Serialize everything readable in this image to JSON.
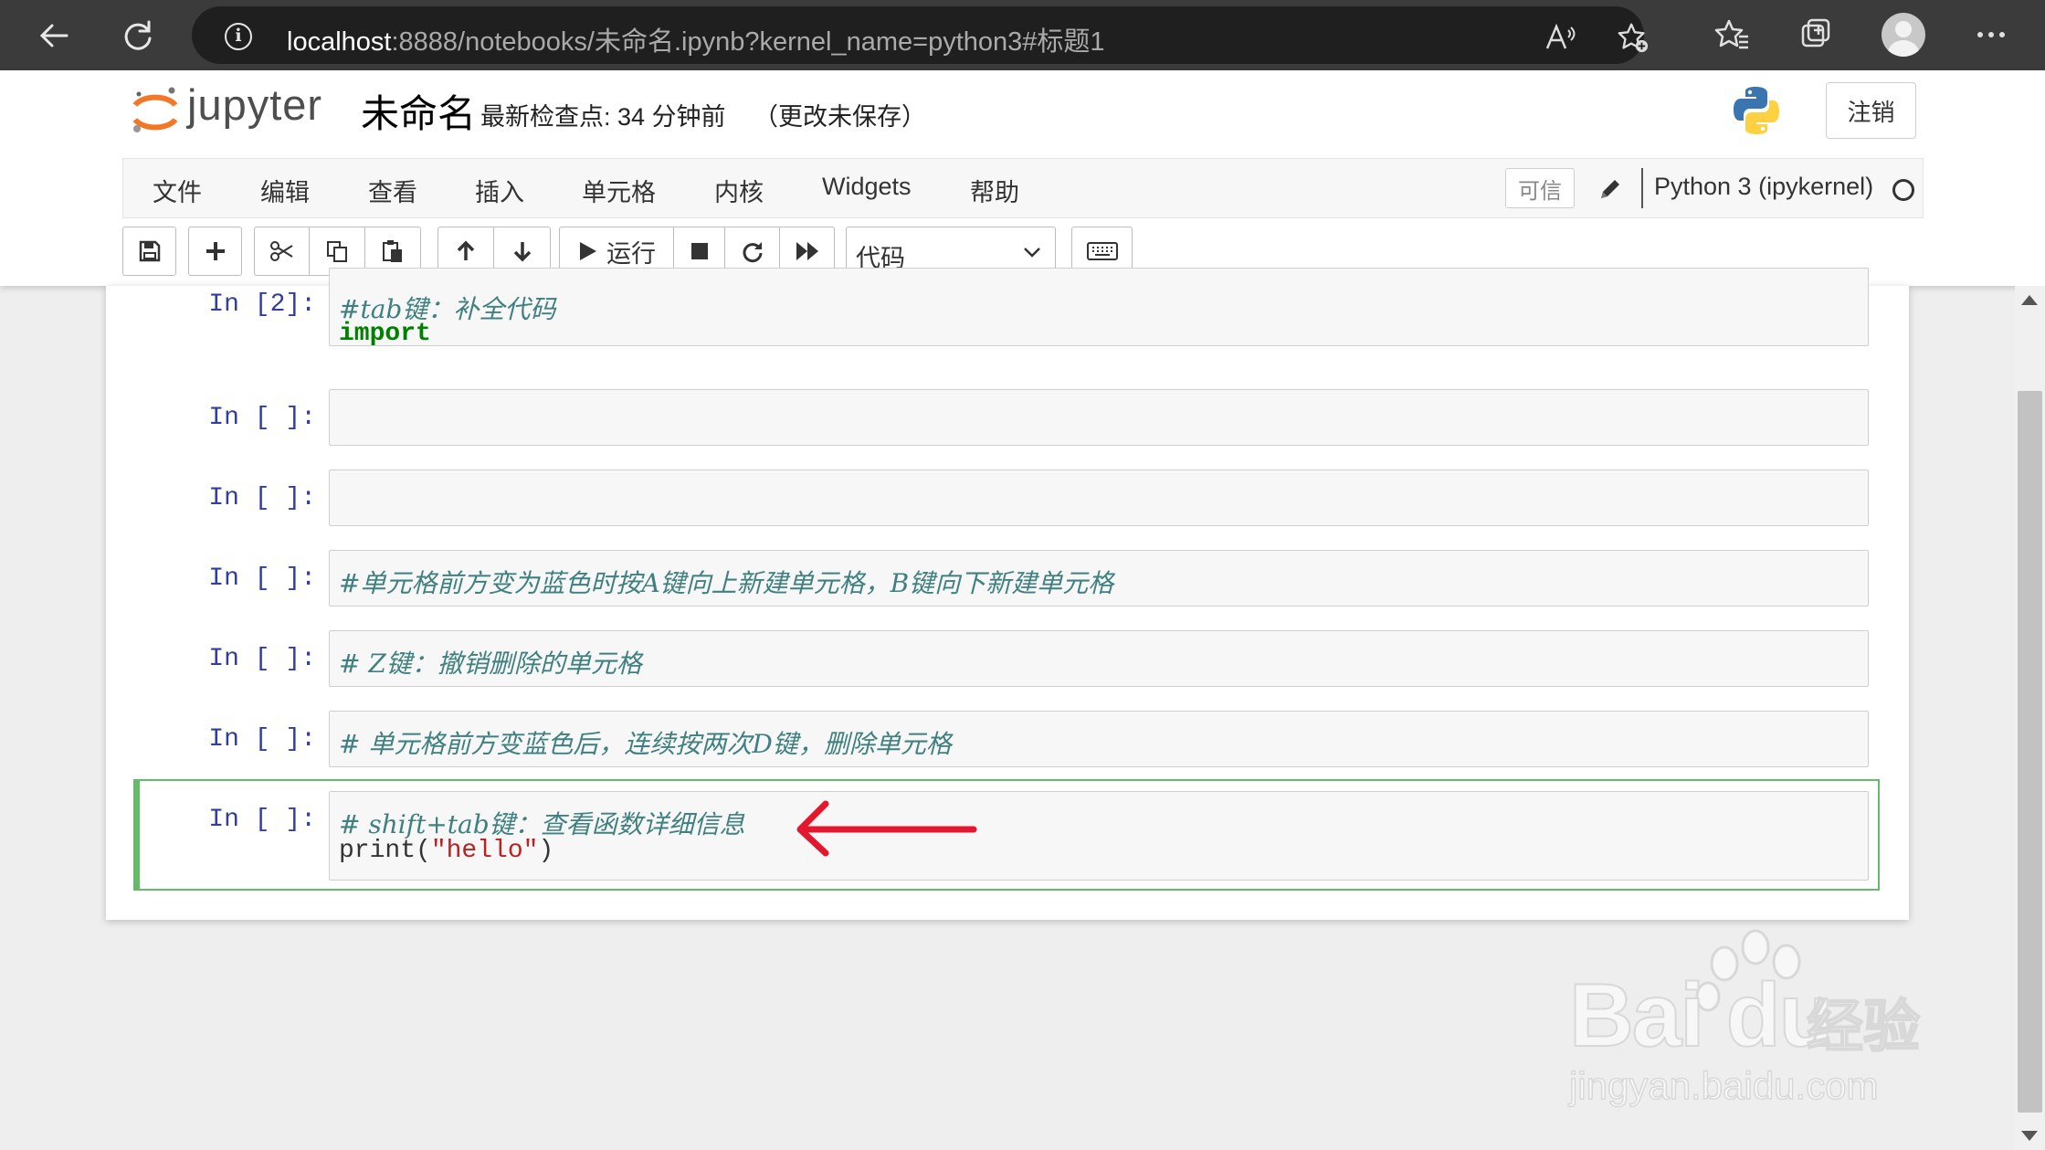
{
  "browser": {
    "url_host": "localhost",
    "url_rest": ":8888/notebooks/未命名.ipynb?kernel_name=python3#标题1"
  },
  "header": {
    "logo_text": "jupyter",
    "notebook_name": "未命名",
    "checkpoint": "最新检查点: 34 分钟前",
    "unsaved": "（更改未保存）",
    "logout_label": "注销"
  },
  "menu": {
    "items": [
      "文件",
      "编辑",
      "查看",
      "插入",
      "单元格",
      "内核",
      "Widgets",
      "帮助"
    ],
    "trusted_label": "可信",
    "kernel_name": "Python 3 (ipykernel)"
  },
  "toolbar": {
    "run_label": "运行",
    "cell_type": "代码"
  },
  "cells": [
    {
      "prompt": "In [2]:",
      "lines": [
        "#tab键：补全代码",
        "import"
      ]
    },
    {
      "prompt": "In [ ]:",
      "lines": []
    },
    {
      "prompt": "In [ ]:",
      "lines": []
    },
    {
      "prompt": "In [ ]:",
      "lines": [
        "#单元格前方变为蓝色时按A键向上新建单元格，B键向下新建单元格"
      ]
    },
    {
      "prompt": "In [ ]:",
      "lines": [
        "# Z键：撤销删除的单元格"
      ]
    },
    {
      "prompt": "In [ ]:",
      "lines": [
        "# 单元格前方变蓝色后，连续按两次D键，删除单元格"
      ]
    },
    {
      "prompt": "In [ ]:",
      "lines": [
        "# shift+tab键：查看函数详细信息",
        "print(\"hello\")"
      ],
      "code_parts": [
        "print(",
        "\"hello\"",
        ")"
      ]
    }
  ],
  "annotation": {
    "arrow_color": "#e3172d"
  },
  "watermark": {
    "brand": "Bai du",
    "cn": "经验",
    "url": "jingyan.baidu.com"
  },
  "colors": {
    "selected_cell": "#66bb6a",
    "prompt": "#303f9f",
    "comment": "#408080",
    "keyword": "#008000"
  }
}
